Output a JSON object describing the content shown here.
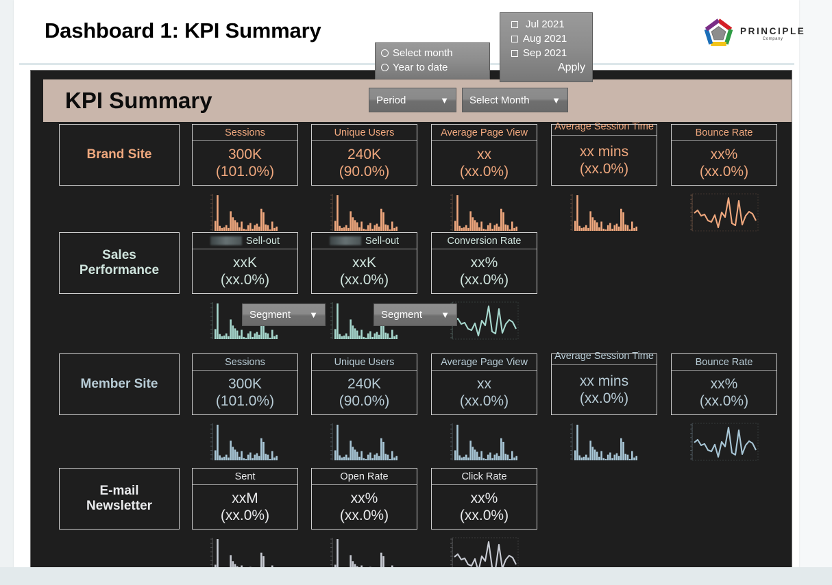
{
  "slide": {
    "title": "Dashboard 1: KPI Summary"
  },
  "logo": {
    "wordmark": "PRINCIPLE",
    "subtitle": "Company",
    "colors": {
      "red": "#d42027",
      "green": "#2e9c45",
      "yellow": "#f2c318",
      "blue": "#1c6fb8",
      "purple": "#7a2d86",
      "center": "#8d8d8d"
    }
  },
  "banner": {
    "title": "KPI Summary",
    "background": "#c9b6ab"
  },
  "controls": {
    "period_button": {
      "label": "Period",
      "caret": "chevron-down-icon"
    },
    "select_month_button": {
      "label": "Select Month",
      "caret": "chevron-down-icon"
    },
    "period_popup": {
      "options": [
        {
          "label": "Select month",
          "selected": false
        },
        {
          "label": "Year to date",
          "selected": false
        }
      ]
    },
    "month_popup": {
      "options": [
        {
          "label": "Jul 2021",
          "checked": false
        },
        {
          "label": "Aug 2021",
          "checked": false
        },
        {
          "label": "Sep 2021",
          "checked": false
        }
      ],
      "apply_label": "Apply"
    },
    "segment_buttons": [
      {
        "label": "Segment",
        "caret": "chevron-down-icon"
      },
      {
        "label": "Segment",
        "caret": "chevron-down-icon"
      }
    ]
  },
  "sections": [
    {
      "id": "brand-site",
      "label": "Brand Site",
      "color": "#f0a87e",
      "cards": [
        {
          "header": "Sessions",
          "value": "300K",
          "delta": "(101.0%)",
          "spark": "bar"
        },
        {
          "header": "Unique Users",
          "value": "240K",
          "delta": "(90.0%)",
          "spark": "bar"
        },
        {
          "header": "Average Page View",
          "value": "xx",
          "delta": "(xx.0%)",
          "spark": "bar"
        },
        {
          "header": "Average Session Time",
          "value": "xx mins",
          "delta": "(xx.0%)",
          "spark": "bar"
        },
        {
          "header": "Bounce Rate",
          "value": "xx%",
          "delta": "(xx.0%)",
          "spark": "line"
        }
      ]
    },
    {
      "id": "sales-performance",
      "label": "Sales\nPerformance",
      "label_line1": "Sales",
      "label_line2": "Performance",
      "color": "#cfe4dd",
      "cards": [
        {
          "header": "Sell-out",
          "redacted": true,
          "value": "xxK",
          "delta": "(xx.0%)",
          "spark": "bar"
        },
        {
          "header": "Sell-out",
          "redacted": true,
          "value": "xxK",
          "delta": "(xx.0%)",
          "spark": "bar"
        },
        {
          "header": "Conversion Rate",
          "redacted": false,
          "value": "xx%",
          "delta": "(xx.0%)",
          "spark": "line"
        }
      ]
    },
    {
      "id": "member-site",
      "label": "Member Site",
      "color": "#b8ccd6",
      "cards": [
        {
          "header": "Sessions",
          "value": "300K",
          "delta": "(101.0%)",
          "spark": "bar"
        },
        {
          "header": "Unique Users",
          "value": "240K",
          "delta": "(90.0%)",
          "spark": "bar"
        },
        {
          "header": "Average Page View",
          "value": "xx",
          "delta": "(xx.0%)",
          "spark": "bar"
        },
        {
          "header": "Average Session Time",
          "value": "xx mins",
          "delta": "(xx.0%)",
          "spark": "bar"
        },
        {
          "header": "Bounce Rate",
          "value": "xx%",
          "delta": "(xx.0%)",
          "spark": "line"
        }
      ]
    },
    {
      "id": "email-newsletter",
      "label_line1": "E-mail",
      "label_line2": "Newsletter",
      "color": "#e9eaec",
      "cards": [
        {
          "header": "Sent",
          "value": "xxM",
          "delta": "(xx.0%)",
          "spark": "bar"
        },
        {
          "header": "Open Rate",
          "value": "xx%",
          "delta": "(xx.0%)",
          "spark": "bar"
        },
        {
          "header": "Click Rate",
          "value": "xx%",
          "delta": "(xx.0%)",
          "spark": "line"
        }
      ]
    }
  ],
  "chart_data": {
    "type": "bar",
    "title": "KPI trend sparklines",
    "grid": false,
    "legend": "none",
    "bar_series": [
      28,
      100,
      14,
      8,
      10,
      16,
      8,
      55,
      38,
      30,
      24,
      10,
      26,
      6,
      4,
      16,
      22,
      6,
      16,
      20,
      12,
      62,
      52,
      18,
      16,
      4,
      26,
      8,
      12
    ],
    "line_series": [
      52,
      60,
      44,
      48,
      30,
      26,
      46,
      10,
      54,
      40,
      96,
      22,
      16,
      88,
      18,
      44,
      56,
      50,
      30
    ],
    "xlabel": "",
    "ylabel": "",
    "ylim": [
      0,
      100
    ],
    "series_colors": {
      "brand-site": "#f0a87e",
      "sales-performance": "#a7d8ce",
      "member-site": "#a8c6d6",
      "email-newsletter": "#c9ccd4"
    }
  }
}
